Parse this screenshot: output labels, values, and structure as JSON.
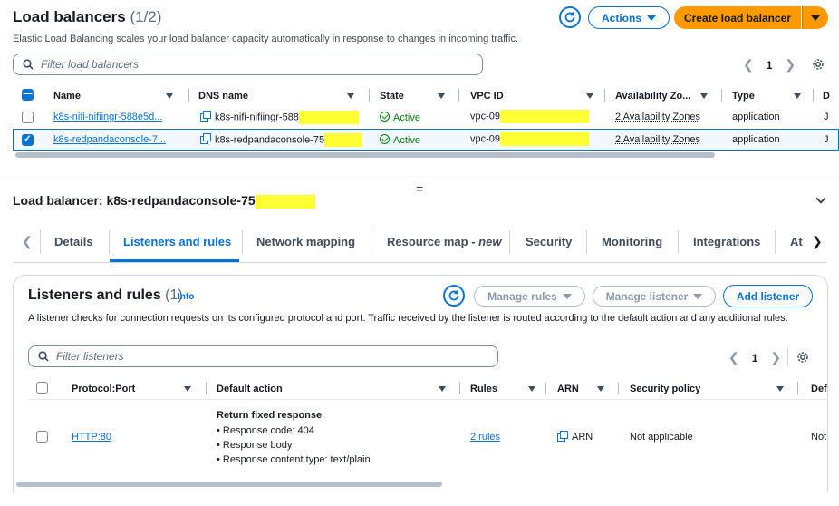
{
  "header": {
    "title": "Load balancers",
    "count": "(1/2)",
    "subtitle": "Elastic Load Balancing scales your load balancer capacity automatically in response to changes in incoming traffic.",
    "actions_label": "Actions",
    "create_label": "Create load balancer"
  },
  "search": {
    "placeholder": "Filter load balancers"
  },
  "pager": {
    "page": "1"
  },
  "table": {
    "columns": [
      "Name",
      "DNS name",
      "State",
      "VPC ID",
      "Availability Zo...",
      "Type",
      "D"
    ],
    "rows": [
      {
        "name": "k8s-nifi-nifiingr-588e5d...",
        "dns": "k8s-nifi-nifiingr-588",
        "state": "Active",
        "vpc": "vpc-09",
        "az": "2 Availability Zones",
        "type": "application",
        "d": "J",
        "selected": false
      },
      {
        "name": "k8s-redpandaconsole-7...",
        "dns": "k8s-redpandaconsole-75",
        "state": "Active",
        "vpc": "vpc-09",
        "az": "2 Availability Zones",
        "type": "application",
        "d": "J",
        "selected": true
      }
    ]
  },
  "detail": {
    "title": "Load balancer: k8s-redpandaconsole-75",
    "tabs": [
      "Details",
      "Listeners and rules",
      "Network mapping",
      "Resource map -",
      "new",
      "Security",
      "Monitoring",
      "Integrations",
      "At"
    ],
    "active_tab": "Listeners and rules"
  },
  "listeners": {
    "title": "Listeners and rules",
    "count": "(1)",
    "info": "Info",
    "manage_rules": "Manage rules",
    "manage_listener": "Manage listener",
    "add_listener": "Add listener",
    "description": "A listener checks for connection requests on its configured protocol and port. Traffic received by the listener is routed according to the default action and any additional rules.",
    "search_placeholder": "Filter listeners",
    "page": "1",
    "columns": [
      "Protocol:Port",
      "Default action",
      "Rules",
      "ARN",
      "Security policy",
      "Def"
    ],
    "row": {
      "protocol_port": "HTTP:80",
      "action_title": "Return fixed response",
      "action_items": [
        "Response code: 404",
        "Response body",
        "Response content type: text/plain"
      ],
      "rules": "2 rules",
      "arn": "ARN",
      "security_policy": "Not applicable",
      "def": "Not"
    }
  },
  "colors": {
    "accent": "#0972d3",
    "primary": "#ff9900",
    "success": "#037f0c",
    "redaction": "#ffff33"
  }
}
